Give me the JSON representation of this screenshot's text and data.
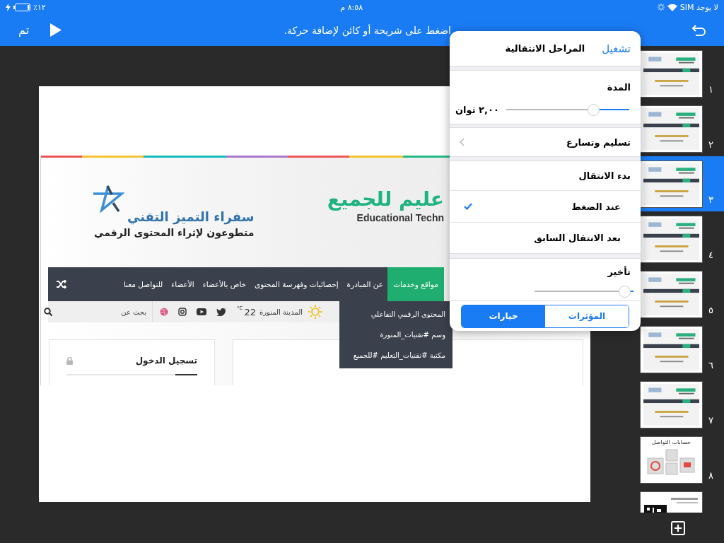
{
  "status_bar": {
    "carrier": "لا يوجد SIM",
    "time": "٨:٥٨ م",
    "battery": "٪١٢",
    "charging": true
  },
  "toolbar": {
    "title": "اضغط على شريحة أو كائن لإضافة حركة.",
    "done": "تم"
  },
  "slide": {
    "website": {
      "site_title": "عليم للجميع",
      "site_subtitle": "Educational Techn",
      "partner_title": "سفراء التميز التقني",
      "partner_tagline": "متطوعون لإثراء المحتوى الرقمي",
      "menu": [
        {
          "label": "مواقع وخدمات",
          "selected": true
        },
        {
          "label": "عن المبادرة",
          "selected": false
        },
        {
          "label": "إحصائيات وفهرسة المحتوى",
          "selected": false
        },
        {
          "label": "خاص بالأعضاء",
          "selected": false
        },
        {
          "label": "الأعضاء",
          "selected": false
        },
        {
          "label": "للتواصل معنا",
          "selected": false
        }
      ],
      "submenu": [
        "المحتوى الرقمي التفاعلي",
        "وسم #تقنيات_المنورة",
        "مكتبة #تقنيات_التعليم #للجميع"
      ],
      "weather": {
        "city": "المدينة المنورة",
        "temperature": "22",
        "unit": "°C"
      },
      "search": {
        "placeholder": "بحث عن"
      },
      "login": {
        "title": "تسجيل الدخول"
      }
    }
  },
  "popover": {
    "play": "تشغيل",
    "title": "المراحل الانتقالية",
    "duration": {
      "label": "المدة",
      "level": 0.27,
      "reading": "٢,٠٠ ثوان"
    },
    "easing": {
      "label": "تسليم وتسارع"
    },
    "start": {
      "label": "بدء الانتقال",
      "options": [
        {
          "label": "عند الضغط",
          "selected": true
        },
        {
          "label": "بعد الانتقال السابق",
          "selected": false
        }
      ]
    },
    "delay": {
      "label": "تأخير",
      "level": 0.03
    },
    "segments": [
      {
        "label": "المؤثرات",
        "selected": false
      },
      {
        "label": "خيارات",
        "selected": true
      }
    ]
  },
  "slides": [
    {
      "number": "١",
      "selected": false,
      "kind": "web"
    },
    {
      "number": "٢",
      "selected": false,
      "kind": "web"
    },
    {
      "number": "٣",
      "selected": true,
      "kind": "web"
    },
    {
      "number": "٤",
      "selected": false,
      "kind": "web"
    },
    {
      "number": "٥",
      "selected": false,
      "kind": "web"
    },
    {
      "number": "٦",
      "selected": false,
      "kind": "web"
    },
    {
      "number": "٧",
      "selected": false,
      "kind": "web"
    },
    {
      "number": "٨",
      "selected": false,
      "kind": "contact",
      "caption": "حسابات التواصل"
    },
    {
      "selected": false,
      "kind": "qr"
    }
  ]
}
